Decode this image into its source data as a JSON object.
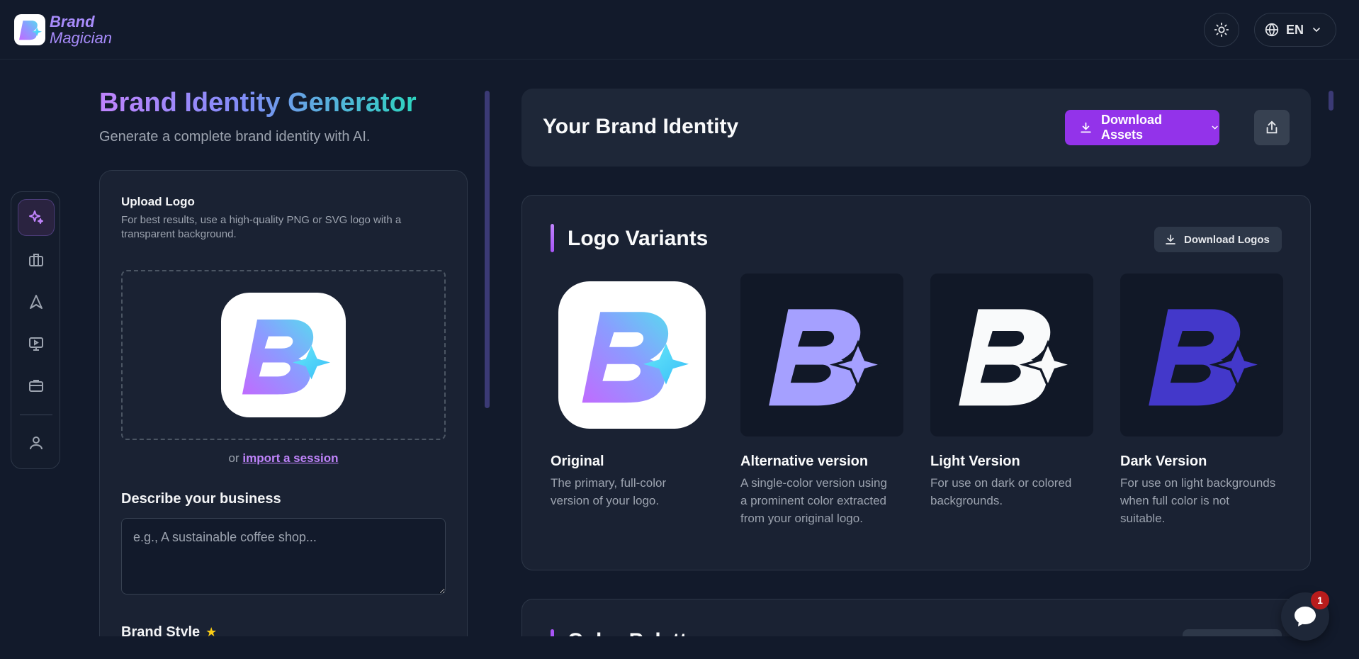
{
  "brand": {
    "name_line1": "Brand",
    "name_line2": "Magician"
  },
  "header": {
    "theme_icon": "sun-icon",
    "language": "EN",
    "language_icon": "globe-icon"
  },
  "sidenav": {
    "items": [
      {
        "icon": "sparkles-icon",
        "active": true
      },
      {
        "icon": "briefcase-icon",
        "active": false
      },
      {
        "icon": "navigation-arrow-icon",
        "active": false
      },
      {
        "icon": "monitor-play-icon",
        "active": false
      },
      {
        "icon": "toolbox-icon",
        "active": false
      },
      {
        "icon": "user-icon",
        "active": false
      }
    ]
  },
  "page": {
    "title": "Brand Identity Generator",
    "subtitle": "Generate a complete brand identity with AI."
  },
  "upload": {
    "label": "Upload Logo",
    "hint": "For best results, use a high-quality PNG or SVG logo with a transparent background.",
    "import_prefix": "or",
    "import_link": "import a session"
  },
  "describe": {
    "label": "Describe your business",
    "placeholder": "e.g., A sustainable coffee shop...",
    "value": ""
  },
  "brand_style": {
    "label": "Brand Style"
  },
  "identity": {
    "title": "Your Brand Identity",
    "download_assets": "Download Assets"
  },
  "logo_variants": {
    "title": "Logo Variants",
    "download_logos": "Download Logos",
    "variants": [
      {
        "name": "Original",
        "desc": "The primary, full-color version of your logo."
      },
      {
        "name": "Alternative version",
        "desc": "A single-color version using a prominent color extracted from your original logo."
      },
      {
        "name": "Light Version",
        "desc": "For use on dark or colored backgrounds."
      },
      {
        "name": "Dark Version",
        "desc": "For use on light backgrounds when full color is not suitable."
      }
    ]
  },
  "color_palette": {
    "title": "Color Palette"
  },
  "chat": {
    "badge_count": "1"
  },
  "colors": {
    "accent": "#9333ea",
    "background": "#121a2b",
    "card": "#1a2233",
    "alt_logo": "#a5a0ff",
    "dark_logo": "#4338ca"
  }
}
